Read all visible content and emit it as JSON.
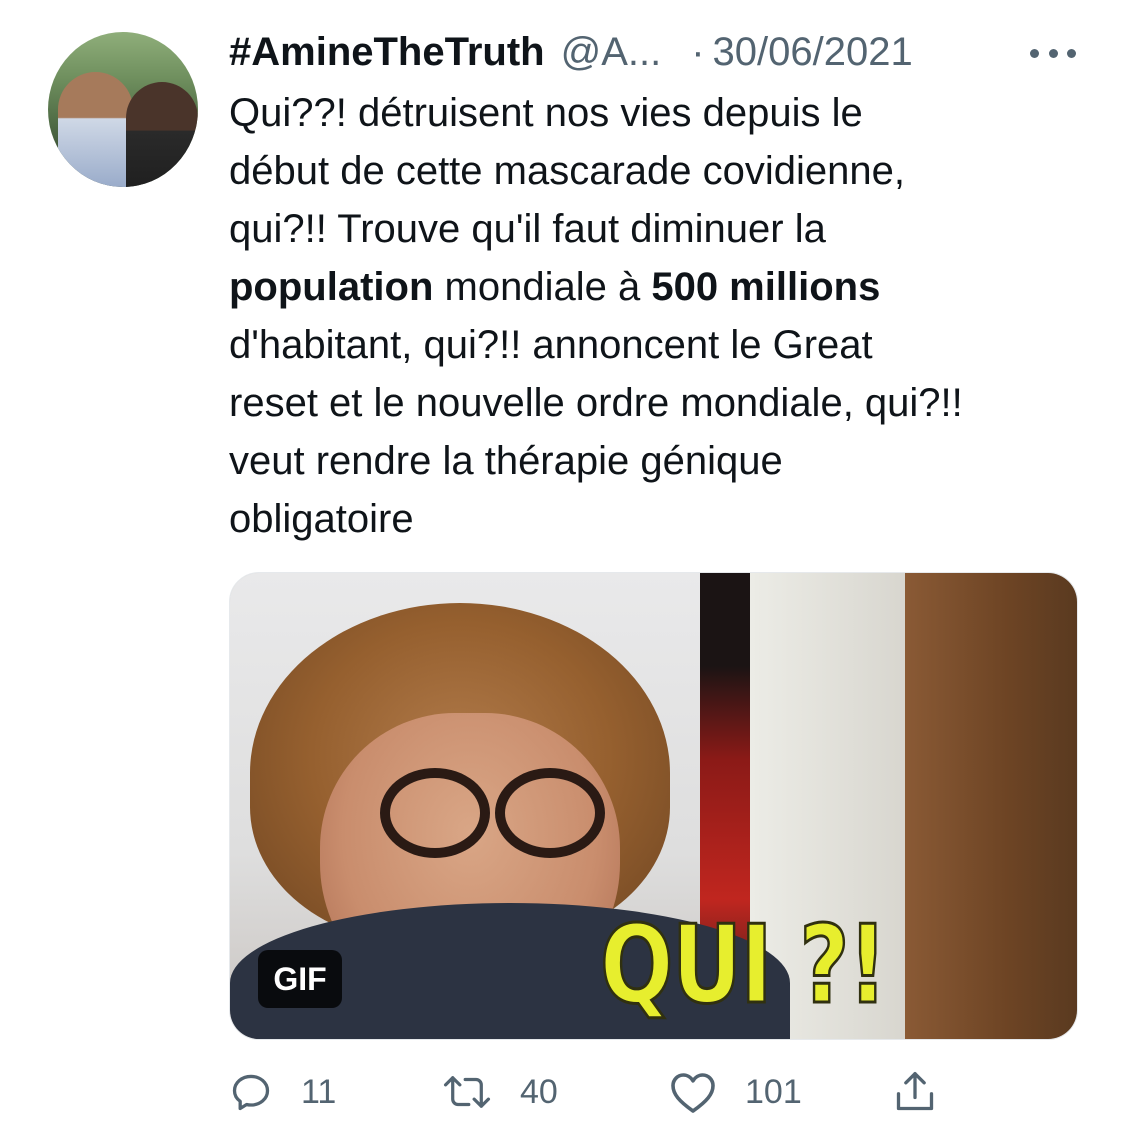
{
  "tweet": {
    "display_name": "#AmineTheTruth",
    "handle": "@A...",
    "separator": "·",
    "date": "30/06/2021",
    "text_lines": [
      [
        {
          "t": "Qui??! détruisent nos vies depuis le",
          "b": false
        }
      ],
      [
        {
          "t": "début de cette mascarade covidienne,",
          "b": false
        }
      ],
      [
        {
          "t": "qui?!! Trouve qu'il faut diminuer la",
          "b": false
        }
      ],
      [
        {
          "t": "population",
          "b": true
        },
        {
          "t": " mondiale à ",
          "b": false
        },
        {
          "t": "500 millions",
          "b": true
        }
      ],
      [
        {
          "t": "d'habitant, qui?!! annoncent le Great",
          "b": false
        }
      ],
      [
        {
          "t": "reset et le nouvelle ordre mondiale, qui?!!",
          "b": false
        }
      ],
      [
        {
          "t": "veut rendre la thérapie génique",
          "b": false
        }
      ],
      [
        {
          "t": "obligatoire",
          "b": false
        }
      ]
    ],
    "media": {
      "badge": "GIF",
      "overlay_text": "QUI ?!"
    },
    "actions": {
      "replies": "11",
      "retweets": "40",
      "likes": "101"
    }
  },
  "icons": {
    "reply": "reply-icon",
    "retweet": "retweet-icon",
    "like": "heart-icon",
    "share": "share-icon",
    "more": "more-icon"
  },
  "colors": {
    "text": "#0f1419",
    "secondary": "#536471",
    "overlay_yellow": "#e7ee2e"
  }
}
